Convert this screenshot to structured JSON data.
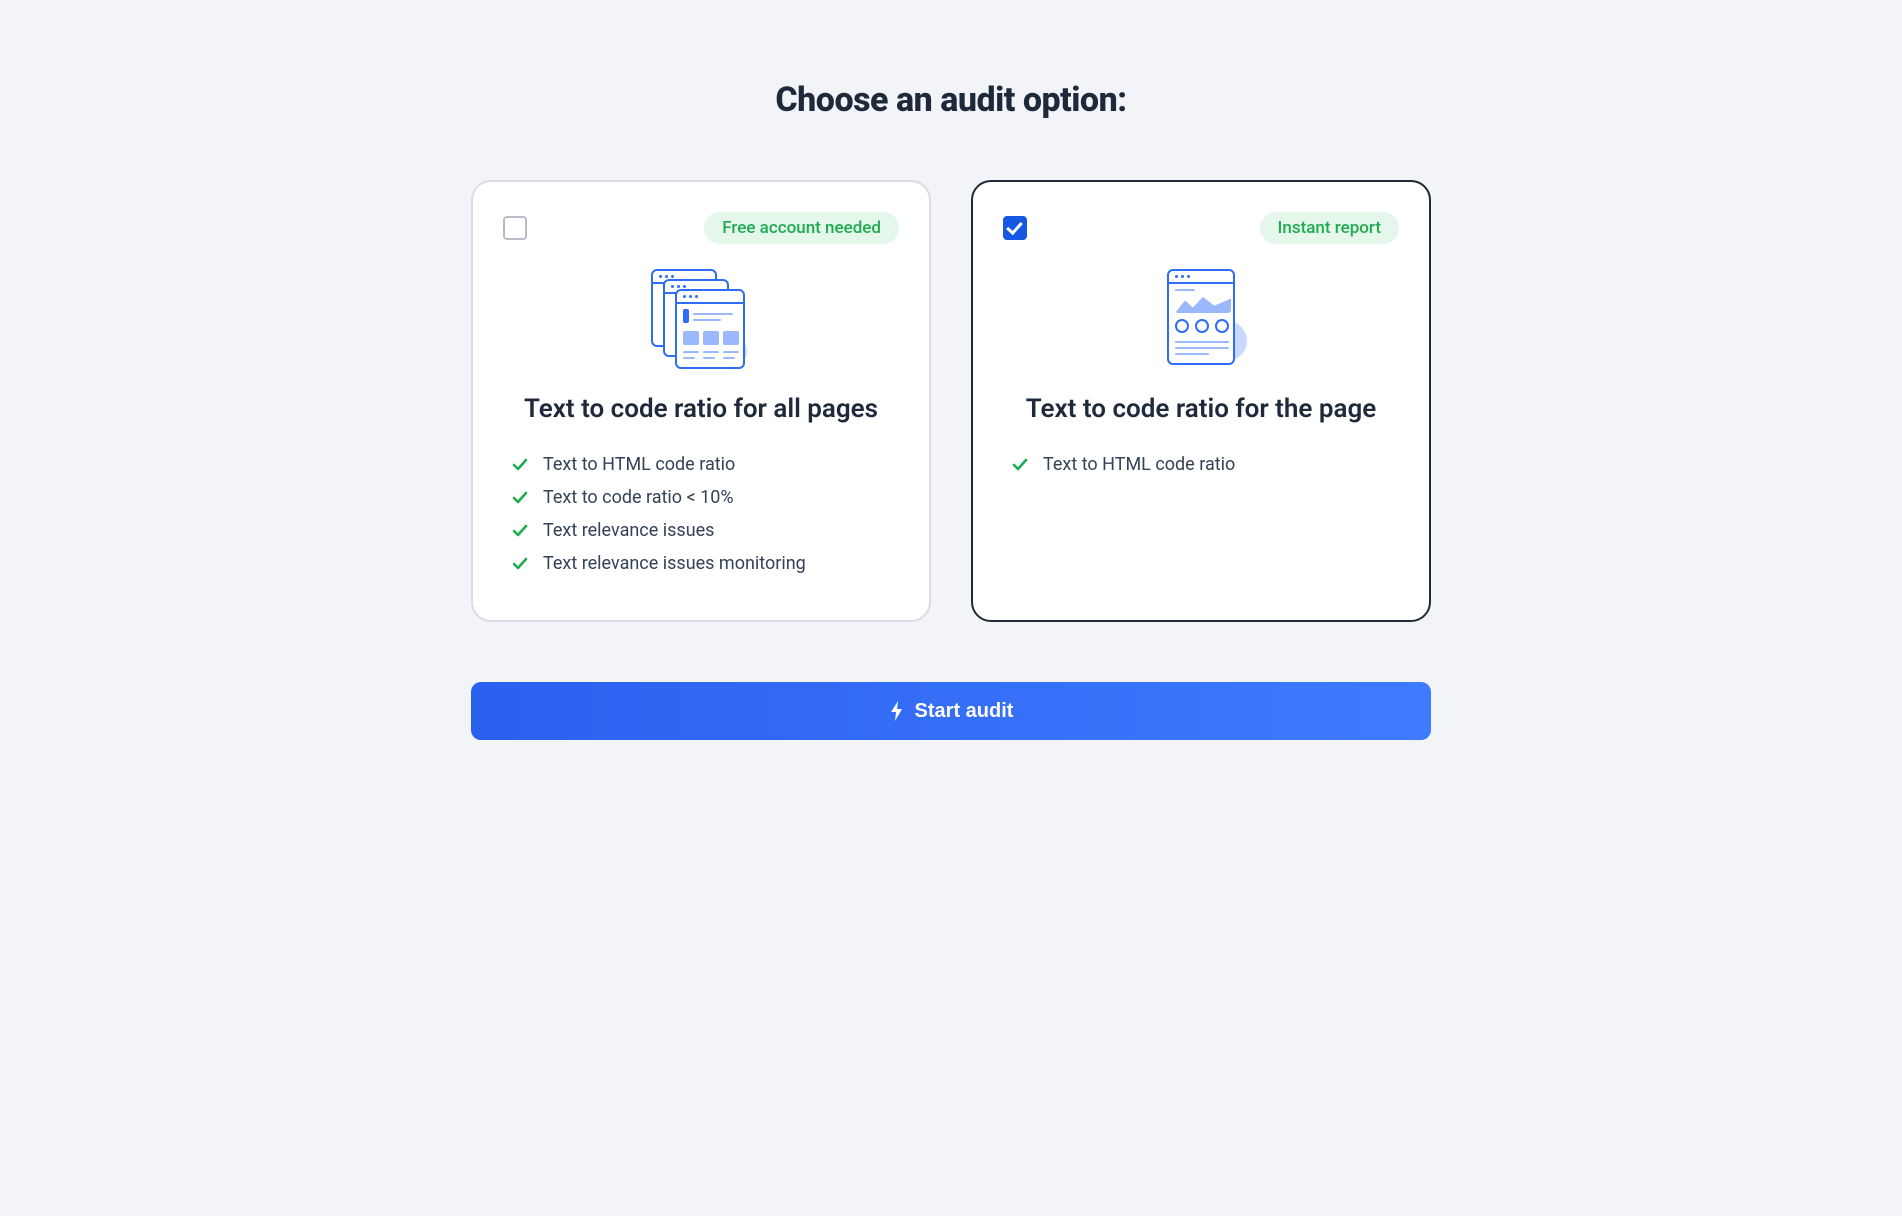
{
  "title": "Choose an audit option:",
  "options": [
    {
      "selected": false,
      "badge": "Free account needed",
      "heading": "Text to code ratio for all pages",
      "features": [
        "Text to HTML code ratio",
        "Text to code ratio < 10%",
        "Text relevance issues",
        "Text relevance issues monitoring"
      ]
    },
    {
      "selected": true,
      "badge": "Instant report",
      "heading": "Text to code ratio for the page",
      "features": [
        "Text to HTML code ratio"
      ]
    }
  ],
  "cta_label": "Start audit"
}
